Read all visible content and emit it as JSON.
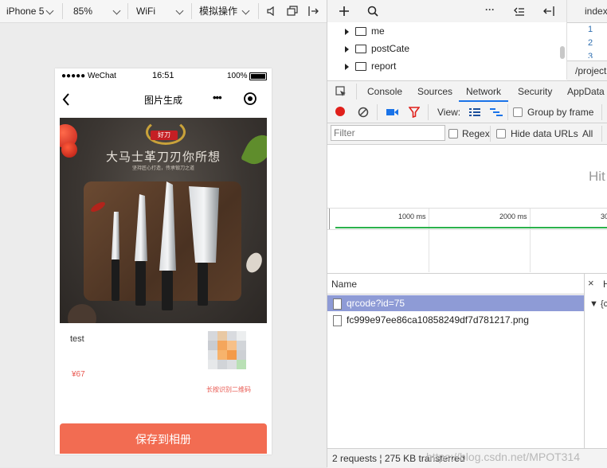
{
  "toolbar": {
    "device": "iPhone 5",
    "zoom": "85%",
    "network": "WiFi",
    "operation": "模拟操作"
  },
  "phone": {
    "status": {
      "carrier": "●●●●● WeChat",
      "time": "16:51",
      "battery": "100%"
    },
    "nav": {
      "title": "图片生成",
      "more_glyph": "•••"
    },
    "poster": {
      "badge_text": "好刀",
      "headline": "大马士革刀刃你所想",
      "subline": "坚持匠心打造，传承锻刀之道"
    },
    "card": {
      "product_name": "test",
      "price": "¥67",
      "qr_hint": "长按识别二维码"
    },
    "save_button": "保存到相册"
  },
  "devtools": {
    "editor_tab": "index",
    "editor_lines": [
      "1",
      "2",
      "3"
    ],
    "editor_path": "/project.",
    "file_tree": [
      "me",
      "postCate",
      "report"
    ],
    "panel_tabs": [
      "Console",
      "Sources",
      "Network",
      "Security",
      "AppData"
    ],
    "active_tab": "Network",
    "view_label": "View:",
    "group_by_frame": "Group by frame",
    "filter_placeholder": "Filter",
    "regex_label": "Regex",
    "hide_data_urls": "Hide data URLs",
    "all_label": "All",
    "overview_hint": "Hit",
    "timeline_ticks": [
      "1000 ms",
      "2000 ms",
      "30"
    ],
    "name_header": "Name",
    "requests": [
      {
        "name": "qrcode?id=75",
        "selected": true
      },
      {
        "name": "fc999e97ee86ca10858249df7d781217.png",
        "selected": false
      }
    ],
    "right_header": "H",
    "right_row": "▼ {c",
    "summary": "2 requests  ¦  275 KB transferred",
    "watermark": "https://blog.csdn.net/MPOT314"
  },
  "colors": {
    "accent_save": "#f26c52",
    "price_red": "#e8574f",
    "selected_row": "#8e9bd6",
    "record_red": "#e0201b",
    "timeline_green": "#2bb24c"
  }
}
